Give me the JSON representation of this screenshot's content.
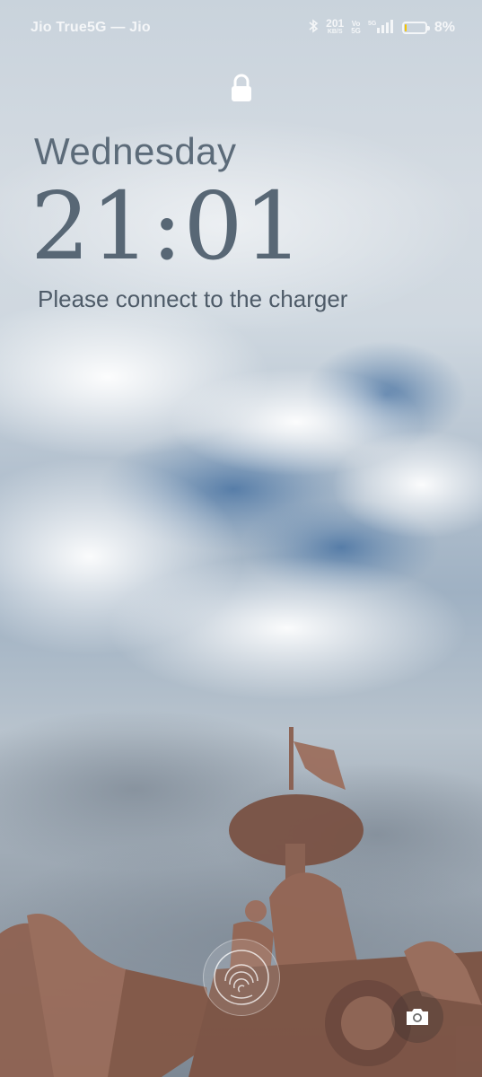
{
  "status_bar": {
    "carrier": "Jio True5G — Jio",
    "net_speed_value": "201",
    "net_speed_unit": "KB/S",
    "volte_label": "Vo\n5G",
    "network_label": "5G",
    "battery_percent": "8%",
    "battery_level": 0.08,
    "icons": [
      "bluetooth-icon",
      "signal-icon",
      "battery-icon"
    ]
  },
  "lock_screen": {
    "day": "Wednesday",
    "time": "21:01",
    "message": "Please connect to the charger"
  },
  "controls": {
    "fingerprint": "fingerprint-icon",
    "camera": "camera-icon"
  },
  "colors": {
    "battery_fill": "#f5c400",
    "clock_text": "#586775"
  }
}
